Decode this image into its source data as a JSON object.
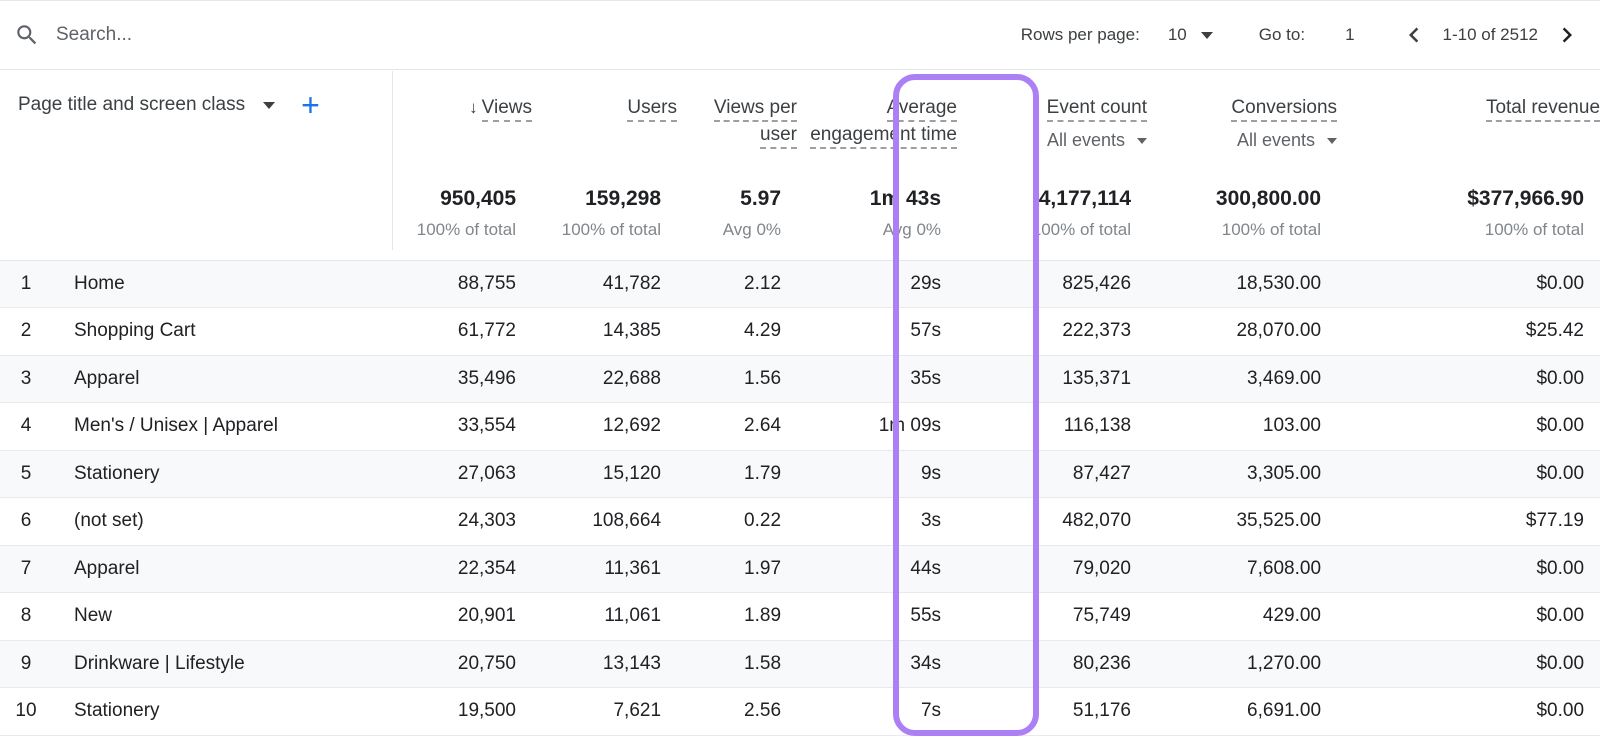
{
  "toolbar": {
    "search_placeholder": "Search...",
    "search_value": "",
    "search_icon": "search-icon",
    "rows_per_page_label": "Rows per page:",
    "rows_per_page_value": "10",
    "goto_label": "Go to:",
    "goto_value": "1",
    "range_text": "1-10 of 2512",
    "prev_icon": "chevron-left-icon",
    "next_icon": "chevron-right-icon"
  },
  "table": {
    "dimension": {
      "label": "Page title and screen class",
      "caret_icon": "chevron-down-icon",
      "add_icon": "plus-icon"
    },
    "columns": [
      {
        "label": "Views",
        "sorted": true,
        "sort_icon": "arrow-down-icon",
        "sub": null
      },
      {
        "label": "Users",
        "sorted": false,
        "sub": null
      },
      {
        "label": "Views per user",
        "sorted": false,
        "sub": null
      },
      {
        "label": "Average engagement time",
        "sorted": false,
        "sub": null,
        "highlighted": true
      },
      {
        "label": "Event count",
        "sorted": false,
        "sub": "All events"
      },
      {
        "label": "Conversions",
        "sorted": false,
        "sub": "All events"
      },
      {
        "label": "Total revenue",
        "sorted": false,
        "sub": null
      }
    ],
    "totals": [
      {
        "value": "950,405",
        "sub": "100% of total"
      },
      {
        "value": "159,298",
        "sub": "100% of total"
      },
      {
        "value": "5.97",
        "sub": "Avg 0%"
      },
      {
        "value": "1m 43s",
        "sub": "Avg 0%"
      },
      {
        "value": "4,177,114",
        "sub": "100% of total"
      },
      {
        "value": "300,800.00",
        "sub": "100% of total"
      },
      {
        "value": "$377,966.90",
        "sub": "100% of total"
      }
    ],
    "rows": [
      {
        "rank": "1",
        "name": "Home",
        "views": "88,755",
        "users": "41,782",
        "views_per_user": "2.12",
        "avg_engagement": "29s",
        "event_count": "825,426",
        "conversions": "18,530.00",
        "total_revenue": "$0.00"
      },
      {
        "rank": "2",
        "name": "Shopping Cart",
        "views": "61,772",
        "users": "14,385",
        "views_per_user": "4.29",
        "avg_engagement": "57s",
        "event_count": "222,373",
        "conversions": "28,070.00",
        "total_revenue": "$25.42"
      },
      {
        "rank": "3",
        "name": "Apparel",
        "views": "35,496",
        "users": "22,688",
        "views_per_user": "1.56",
        "avg_engagement": "35s",
        "event_count": "135,371",
        "conversions": "3,469.00",
        "total_revenue": "$0.00"
      },
      {
        "rank": "4",
        "name": "Men's / Unisex | Apparel",
        "views": "33,554",
        "users": "12,692",
        "views_per_user": "2.64",
        "avg_engagement": "1m 09s",
        "event_count": "116,138",
        "conversions": "103.00",
        "total_revenue": "$0.00"
      },
      {
        "rank": "5",
        "name": "Stationery",
        "views": "27,063",
        "users": "15,120",
        "views_per_user": "1.79",
        "avg_engagement": "9s",
        "event_count": "87,427",
        "conversions": "3,305.00",
        "total_revenue": "$0.00"
      },
      {
        "rank": "6",
        "name": "(not set)",
        "views": "24,303",
        "users": "108,664",
        "views_per_user": "0.22",
        "avg_engagement": "3s",
        "event_count": "482,070",
        "conversions": "35,525.00",
        "total_revenue": "$77.19"
      },
      {
        "rank": "7",
        "name": "Apparel",
        "views": "22,354",
        "users": "11,361",
        "views_per_user": "1.97",
        "avg_engagement": "44s",
        "event_count": "79,020",
        "conversions": "7,608.00",
        "total_revenue": "$0.00"
      },
      {
        "rank": "8",
        "name": "New",
        "views": "20,901",
        "users": "11,061",
        "views_per_user": "1.89",
        "avg_engagement": "55s",
        "event_count": "75,749",
        "conversions": "429.00",
        "total_revenue": "$0.00"
      },
      {
        "rank": "9",
        "name": "Drinkware | Lifestyle",
        "views": "20,750",
        "users": "13,143",
        "views_per_user": "1.58",
        "avg_engagement": "34s",
        "event_count": "80,236",
        "conversions": "1,270.00",
        "total_revenue": "$0.00"
      },
      {
        "rank": "10",
        "name": "Stationery",
        "views": "19,500",
        "users": "7,621",
        "views_per_user": "2.56",
        "avg_engagement": "7s",
        "event_count": "51,176",
        "conversions": "6,691.00",
        "total_revenue": "$0.00"
      }
    ]
  },
  "annotation": {
    "highlight_color": "#ac7ff4",
    "highlighted_column": "Average engagement time"
  }
}
